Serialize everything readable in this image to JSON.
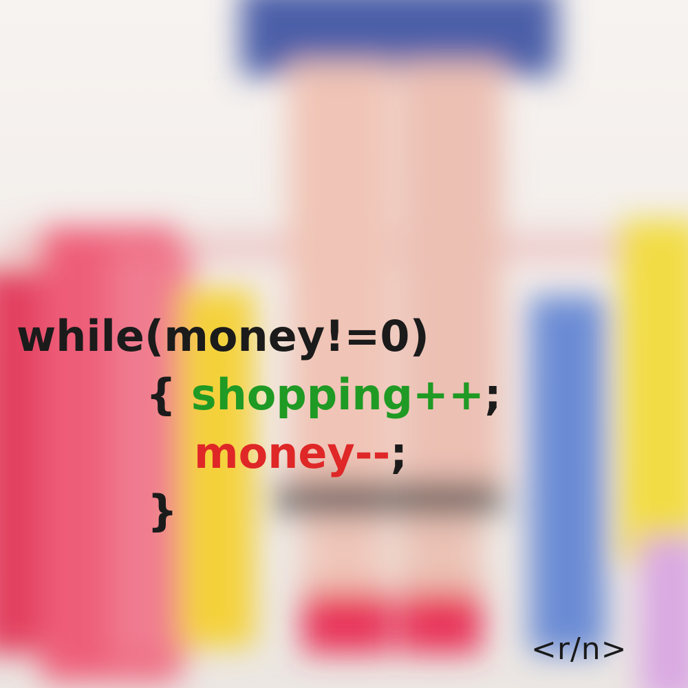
{
  "code": {
    "line1": "while(money!=0)",
    "line2_open": "{ ",
    "line2_statement": "shopping++",
    "line2_semicolon": ";",
    "line3_statement": "money--",
    "line3_semicolon": ";",
    "line4": "}"
  },
  "signature": "<r/n>",
  "colors": {
    "keyword_text": "#1b1b1b",
    "shopping_text": "#1f9a24",
    "money_text": "#df2727"
  }
}
